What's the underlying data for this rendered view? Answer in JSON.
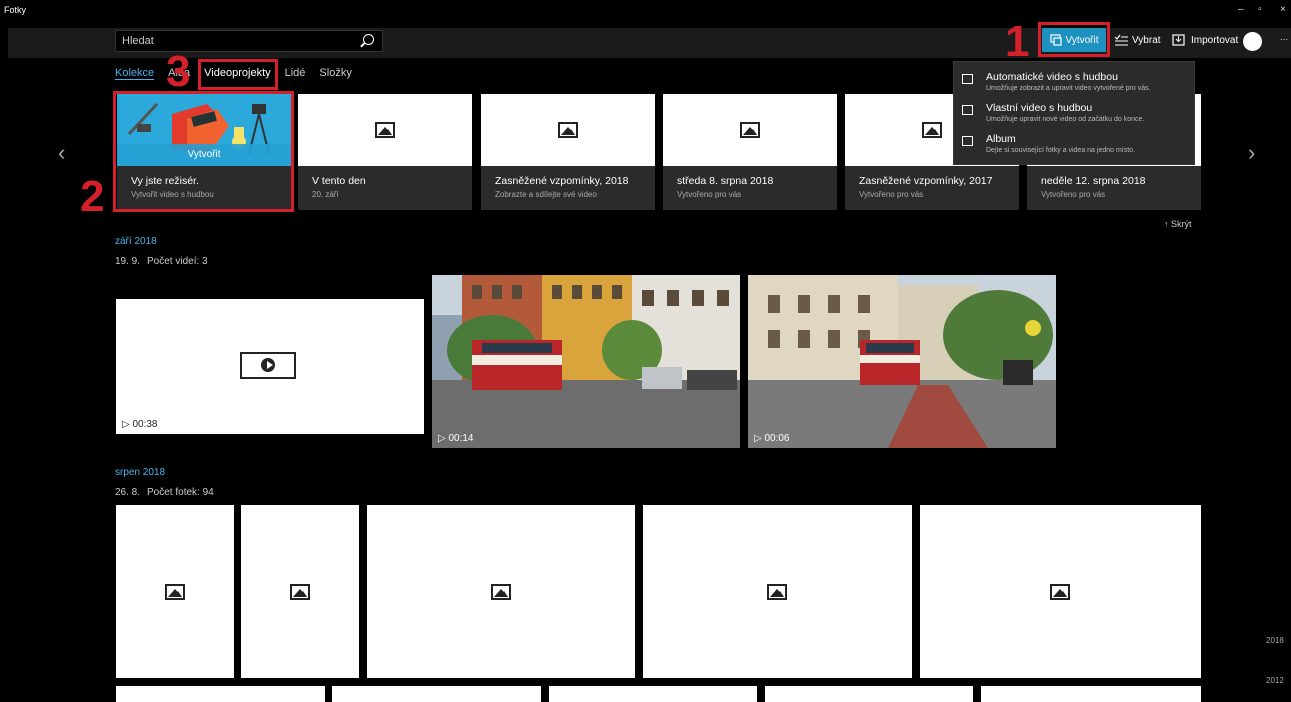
{
  "app": {
    "title": "Fotky"
  },
  "window_controls": {
    "minimize": "–",
    "restore": "▫",
    "close": "×"
  },
  "search": {
    "placeholder": "Hledat"
  },
  "toolbar": {
    "create": "Vytvořit",
    "select": "Vybrat",
    "import": "Importovat",
    "more": "..."
  },
  "callouts": {
    "one": "1",
    "two": "2",
    "three": "3"
  },
  "tabs": [
    {
      "label": "Kolekce"
    },
    {
      "label": "Alba"
    },
    {
      "label": "Videoprojekty"
    },
    {
      "label": "Lidé"
    },
    {
      "label": "Složky"
    }
  ],
  "cards": [
    {
      "title": "Vy jste režisér.",
      "sub": "Vytvořit video s hudbou",
      "overlay": "Vytvořit"
    },
    {
      "title": "V tento den",
      "sub": "20. září"
    },
    {
      "title": "Zasněžené vzpomínky, 2018",
      "sub": "Zobrazte a sdílejte své video"
    },
    {
      "title": "středa 8. srpna 2018",
      "sub": "Vytvořeno pro vás"
    },
    {
      "title": "Zasněžené vzpomínky, 2017",
      "sub": "Vytvořeno pro vás"
    },
    {
      "title": "neděle 12. srpna 2018",
      "sub": "Vytvořeno pro vás"
    }
  ],
  "hide_label": "↑ Skrýt",
  "menu": [
    {
      "title": "Automatické video s hudbou",
      "desc": "Umožňuje zobrazit a upravit video vytvořené pro vás."
    },
    {
      "title": "Vlastní video s hudbou",
      "desc": "Umožňuje upravit nové video od začátku do konce."
    },
    {
      "title": "Album",
      "desc": "Dejte si související fotky a videa na jedno místo."
    }
  ],
  "section1": {
    "month": "září 2018",
    "day": "19. 9.",
    "count": "Počet videí: 3",
    "videos": [
      "▷ 00:38",
      "▷ 00:14",
      "▷ 00:06"
    ]
  },
  "section2": {
    "month": "srpen 2018",
    "day": "26. 8.",
    "count": "Počet fotek: 94"
  },
  "timeline": {
    "y2018": "2018",
    "y2012": "2012"
  },
  "colors": {
    "accent": "#4ab1e8",
    "create_button": "#1d91c0",
    "callout": "#d3202a"
  }
}
